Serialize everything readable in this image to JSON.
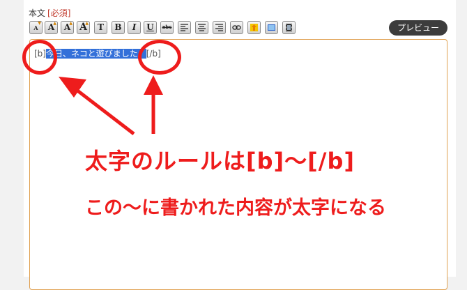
{
  "field": {
    "label": "本文",
    "required": "[必須]"
  },
  "toolbar": {
    "buttons": [
      {
        "icon": "font-size-smaller-icon",
        "glyph": "A"
      },
      {
        "icon": "font-size-small-icon",
        "glyph": "A"
      },
      {
        "icon": "font-size-large-icon",
        "glyph": "A"
      },
      {
        "icon": "font-size-larger-icon",
        "glyph": "A"
      },
      {
        "icon": "text-color-icon",
        "glyph": "T"
      },
      {
        "icon": "bold-icon",
        "glyph": "B"
      },
      {
        "icon": "italic-icon",
        "glyph": "I"
      },
      {
        "icon": "underline-icon",
        "glyph": "U"
      },
      {
        "icon": "strikethrough-icon",
        "glyph": "abc"
      },
      {
        "icon": "align-left-icon",
        "glyph": ""
      },
      {
        "icon": "align-center-icon",
        "glyph": ""
      },
      {
        "icon": "align-right-icon",
        "glyph": ""
      },
      {
        "icon": "link-icon",
        "glyph": ""
      },
      {
        "icon": "upload-icon",
        "glyph": ""
      },
      {
        "icon": "image-icon",
        "glyph": ""
      },
      {
        "icon": "video-icon",
        "glyph": ""
      }
    ],
    "preview_label": "プレビュー"
  },
  "editor": {
    "open_tag": "[b]",
    "selected_text": "今日、ネコと遊びました。",
    "close_tag": "[/b]"
  },
  "annotation": {
    "line1": "太字のルールは[b]〜[/b]",
    "line2": "この〜に書かれた内容が太字になる",
    "color": "#ee1c1c"
  },
  "colors": {
    "selection": "#3370d9",
    "editor_border": "#e0a050",
    "required": "#c0392b"
  }
}
